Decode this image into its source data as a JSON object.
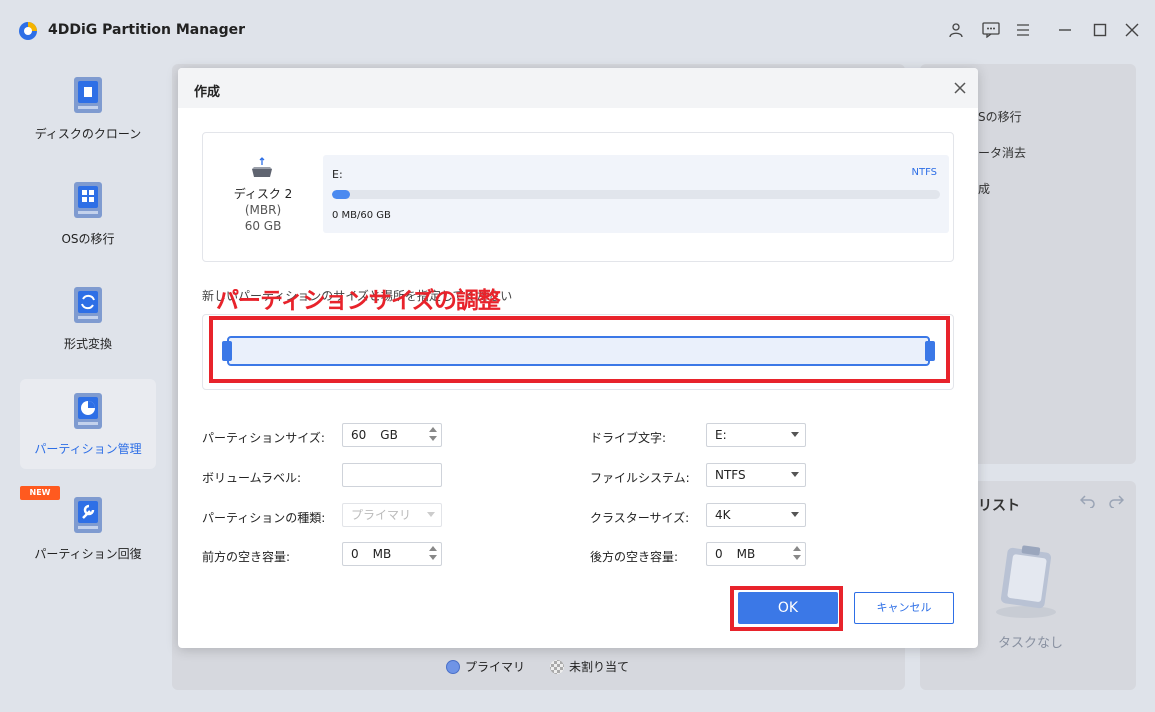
{
  "app": {
    "title": "4DDiG Partition Manager"
  },
  "sidebar": {
    "items": [
      {
        "label": "ディスクのクローン",
        "icon": "disk-clone-icon"
      },
      {
        "label": "OSの移行",
        "icon": "os-migration-icon"
      },
      {
        "label": "形式変換",
        "icon": "format-convert-icon"
      },
      {
        "label": "パーティション管理",
        "icon": "partition-manage-icon",
        "active": true
      },
      {
        "label": "パーティション回復",
        "icon": "partition-recovery-icon"
      }
    ],
    "new_badge": "NEW"
  },
  "background": {
    "right_menu": [
      "Sの移行",
      "ータ消去",
      "成"
    ],
    "task_panel_title": "リスト",
    "task_empty": "タスクなし",
    "legend_primary": "プライマリ",
    "legend_unallocated": "未割り当て"
  },
  "dialog": {
    "title": "作成",
    "disk": {
      "name": "ディスク 2",
      "type": "(MBR)",
      "size": "60 GB",
      "partition_letter": "E:",
      "filesystem": "NTFS",
      "usage_text": "0 MB/60 GB",
      "usage_fraction": 0.02
    },
    "instruction": "新しいパーティションのサイズと場所を指定してください",
    "annotation": "パーティションサイズの調整",
    "form": {
      "partition_size_label": "パーティションサイズ:",
      "partition_size_value": "60",
      "partition_size_unit": "GB",
      "volume_label_label": "ボリュームラベル:",
      "volume_label_value": "",
      "partition_type_label": "パーティションの種類:",
      "partition_type_value": "プライマリ",
      "front_space_label": "前方の空き容量:",
      "front_space_value": "0",
      "front_space_unit": "MB",
      "drive_letter_label": "ドライブ文字:",
      "drive_letter_value": "E:",
      "filesystem_label": "ファイルシステム:",
      "filesystem_value": "NTFS",
      "cluster_size_label": "クラスターサイズ:",
      "cluster_size_value": "4K",
      "back_space_label": "後方の空き容量:",
      "back_space_value": "0",
      "back_space_unit": "MB"
    },
    "ok_label": "OK",
    "cancel_label": "キャンセル"
  },
  "colors": {
    "accent": "#3b78e7",
    "annotation": "#e8232b",
    "badge": "#ff5a1f"
  }
}
